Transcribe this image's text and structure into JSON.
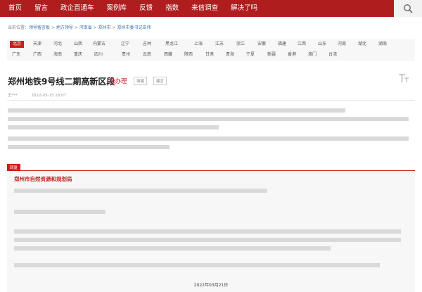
{
  "nav": {
    "items": [
      "首页",
      "留言",
      "政企直通车",
      "案例库",
      "反馈",
      "指数",
      "来信调查",
      "解决了吗"
    ]
  },
  "breadcrumb": {
    "label": "当前位置：",
    "items": [
      "领导留言板",
      "地方领导",
      "河南省",
      "郑州市",
      "郑州市委书记安伟"
    ],
    "separator": ">"
  },
  "regions": [
    "北京",
    "天津",
    "河北",
    "山西",
    "内蒙古",
    "辽宁",
    "吉林",
    "黑龙江",
    "上海",
    "江苏",
    "浙江",
    "安徽",
    "福建",
    "江西",
    "山东",
    "河南",
    "湖北",
    "湖南",
    "广东",
    "广西",
    "海南",
    "重庆",
    "四川",
    "贵州",
    "云南",
    "西藏",
    "陕西",
    "甘肃",
    "青海",
    "宁夏",
    "新疆",
    "香港",
    "澳门",
    "台湾"
  ],
  "active_region": "北京",
  "post": {
    "title": "郑州地铁9号线二期高新区段",
    "status": "已办理",
    "tags": [
      "城建",
      "建言"
    ],
    "author": "王***",
    "date": "2022-03-15 18:07"
  },
  "reply": {
    "label": "回复",
    "org": "郑州市自然资源和规划局",
    "date": "2022年03月21日"
  },
  "colors": {
    "brand_red": "#b01d1f",
    "accent_red": "#c8201f"
  }
}
